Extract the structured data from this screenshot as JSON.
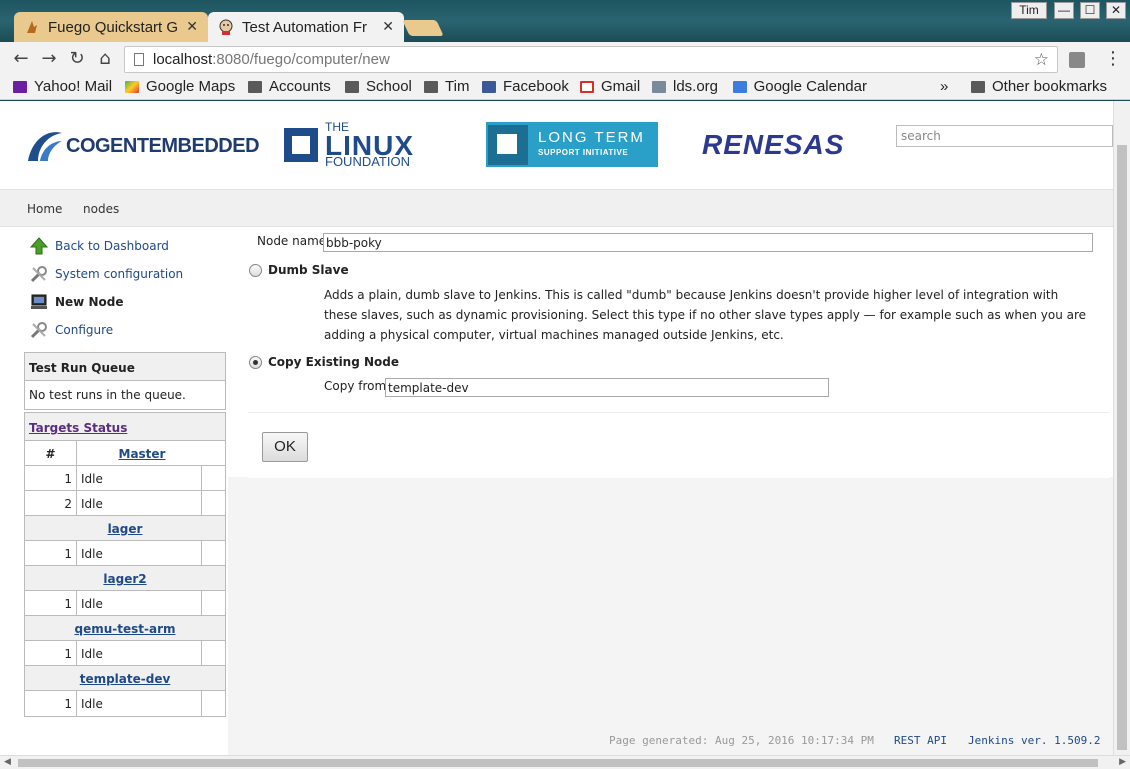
{
  "browser": {
    "tabs": [
      {
        "title": "Fuego Quickstart G",
        "active": false
      },
      {
        "title": "Test Automation Fr",
        "active": true
      }
    ],
    "window_user": "Tim",
    "address": {
      "host": "localhost",
      "rest": ":8080/fuego/computer/new"
    },
    "bookmarks": [
      {
        "label": "Yahoo! Mail",
        "icon": "yahoo-icon"
      },
      {
        "label": "Google Maps",
        "icon": "maps-icon"
      },
      {
        "label": "Accounts",
        "icon": "folder-icon"
      },
      {
        "label": "School",
        "icon": "folder-icon"
      },
      {
        "label": "Tim",
        "icon": "folder-icon"
      },
      {
        "label": "Facebook",
        "icon": "facebook-icon"
      },
      {
        "label": "Gmail",
        "icon": "gmail-icon"
      },
      {
        "label": "lds.org",
        "icon": "lds-icon"
      },
      {
        "label": "Google Calendar",
        "icon": "calendar-icon"
      }
    ],
    "bookmarks_overflow": "»",
    "other_bookmarks": "Other bookmarks"
  },
  "header": {
    "logos": [
      "COGENTEMBEDDED",
      "THE",
      "LINUX",
      "FOUNDATION",
      "LONG TERM",
      "SUPPORT INITIATIVE",
      "RENESAS"
    ],
    "search_placeholder": "search"
  },
  "breadcrumbs": [
    "Home",
    "nodes"
  ],
  "sidebar": {
    "links": [
      {
        "label": "Back to Dashboard",
        "icon": "up-arrow-icon"
      },
      {
        "label": "System configuration",
        "icon": "wrench-icon"
      },
      {
        "label": "New Node",
        "icon": "computer-icon"
      },
      {
        "label": "Configure",
        "icon": "wrench-icon"
      }
    ],
    "queue_title": "Test Run Queue",
    "queue_empty": "No test runs in the queue.",
    "targets_title": "Targets Status",
    "targets_hash": "#",
    "targets_master": "Master",
    "master_rows": [
      {
        "num": "1",
        "status": "Idle"
      },
      {
        "num": "2",
        "status": "Idle"
      }
    ],
    "groups": [
      {
        "name": "lager",
        "num": "1",
        "status": "Idle"
      },
      {
        "name": "lager2",
        "num": "1",
        "status": "Idle"
      },
      {
        "name": "qemu-test-arm",
        "num": "1",
        "status": "Idle"
      },
      {
        "name": "template-dev",
        "num": "1",
        "status": "Idle"
      }
    ]
  },
  "form": {
    "node_name_label": "Node name",
    "node_name_value": "bbb-poky",
    "dumb_slave_label": "Dumb Slave",
    "dumb_slave_desc": "Adds a plain, dumb slave to Jenkins. This is called \"dumb\" because Jenkins doesn't provide higher level of integration with these slaves, such as dynamic provisioning. Select this type if no other slave types apply — for example such as when you are adding a physical computer, virtual machines managed outside Jenkins, etc.",
    "copy_existing_label": "Copy Existing Node",
    "copy_from_label": "Copy from",
    "copy_from_value": "template-dev",
    "ok_label": "OK"
  },
  "footer": {
    "generated": "Page generated: Aug 25, 2016 10:17:34 PM",
    "rest_api": "REST API",
    "version": "Jenkins ver. 1.509.2"
  },
  "colors": {
    "link": "#204a87",
    "visited": "#5a2e7f",
    "tab_inactive": "#e9c98d"
  }
}
